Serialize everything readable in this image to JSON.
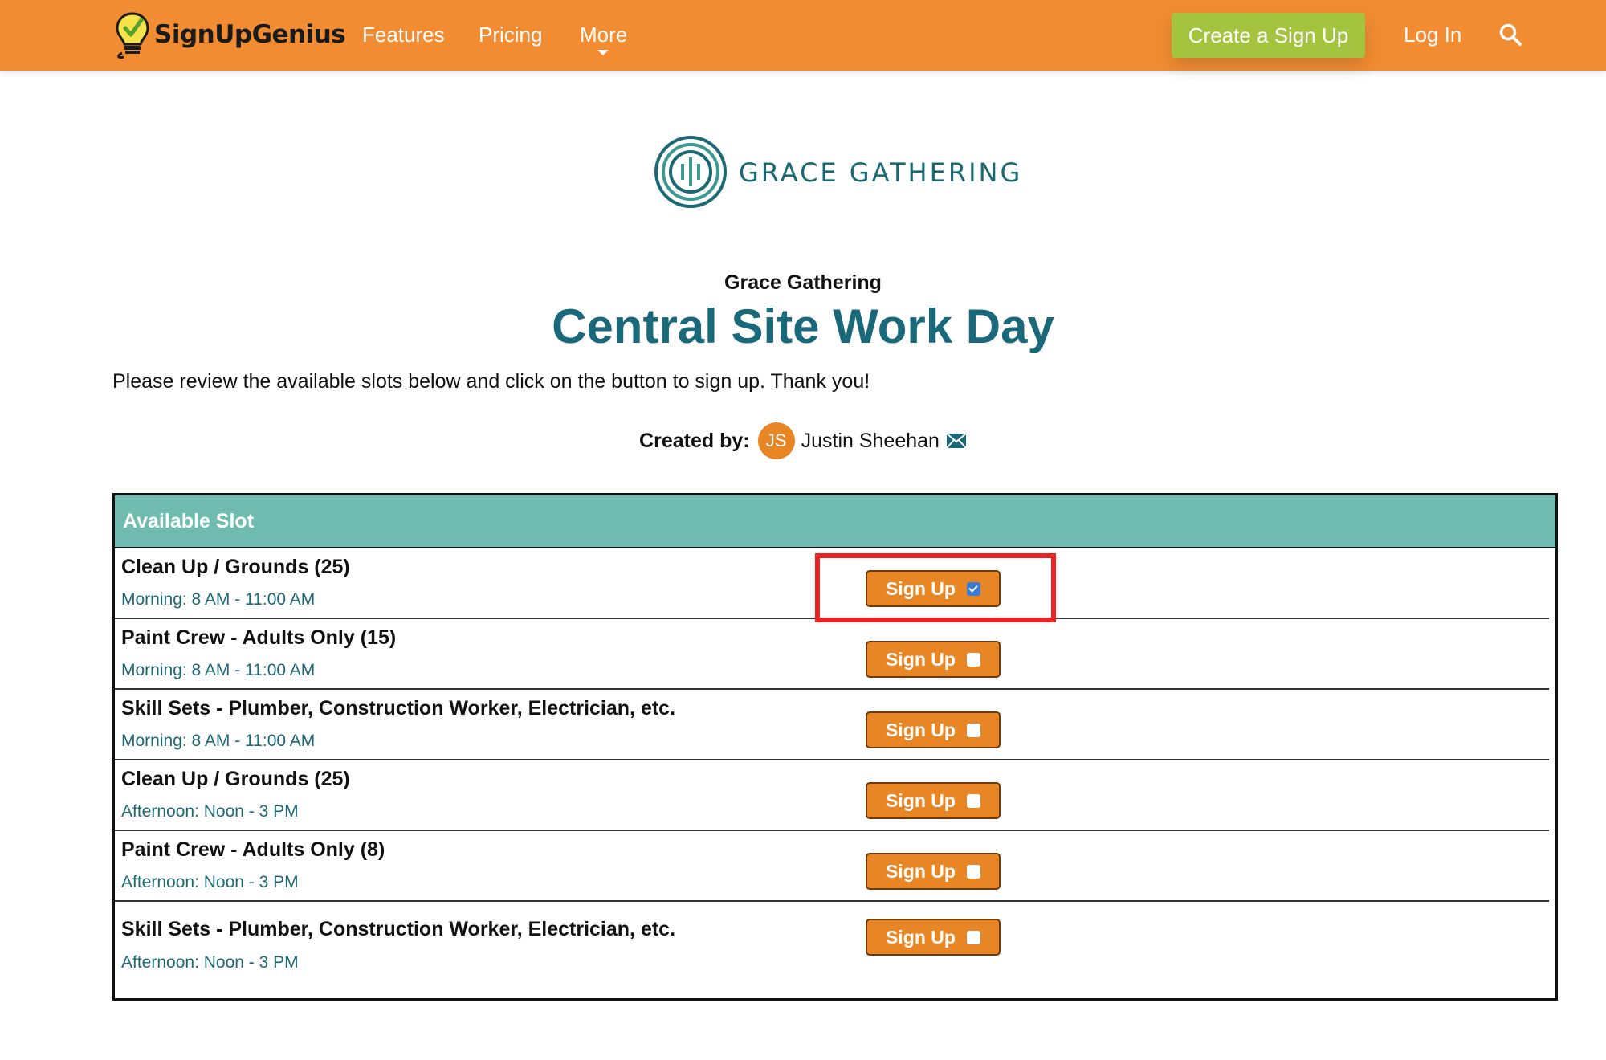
{
  "header": {
    "brand": "SignUpGenius",
    "nav": [
      {
        "label": "Features"
      },
      {
        "label": "Pricing"
      },
      {
        "label": "More"
      }
    ],
    "create_label": "Create a Sign Up",
    "login_label": "Log In",
    "colors": {
      "bar": "#f18c32",
      "create": "#a4c33f"
    }
  },
  "organization": {
    "logo_text": "GRACE GATHERING",
    "name": "Grace Gathering"
  },
  "page": {
    "title": "Central Site Work Day",
    "intro": "Please review the available slots below and click on the button to sign up. Thank you!",
    "created_label": "Created by:",
    "creator_initials": "JS",
    "creator_name": "Justin Sheehan"
  },
  "table": {
    "header": "Available Slot",
    "rows": [
      {
        "title": "Clean Up / Grounds (25)",
        "time": "Morning: 8 AM - 11:00 AM",
        "button": "Sign Up",
        "checked": true
      },
      {
        "title": "Paint Crew - Adults Only (15)",
        "time": "Morning: 8 AM - 11:00 AM",
        "button": "Sign Up",
        "checked": false
      },
      {
        "title": "Skill Sets - Plumber, Construction Worker, Electrician, etc.",
        "time": "Morning: 8 AM - 11:00 AM",
        "button": "Sign Up",
        "checked": false
      },
      {
        "title": "Clean Up / Grounds (25)",
        "time": "Afternoon: Noon - 3 PM",
        "button": "Sign Up",
        "checked": false
      },
      {
        "title": "Paint Crew - Adults Only (8)",
        "time": "Afternoon: Noon - 3 PM",
        "button": "Sign Up",
        "checked": false
      },
      {
        "title": "Skill Sets - Plumber, Construction Worker, Electrician, etc.",
        "time": "Afternoon: Noon - 3 PM",
        "button": "Sign Up",
        "checked": false
      }
    ]
  }
}
